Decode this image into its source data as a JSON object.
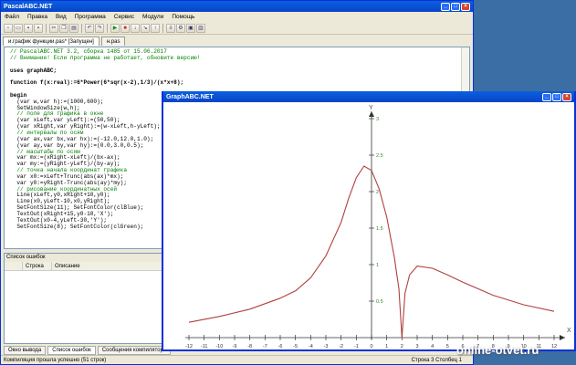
{
  "ide": {
    "title": "PascalABC.NET",
    "menu": [
      "Файл",
      "Правка",
      "Вид",
      "Программа",
      "Сервис",
      "Модули",
      "Помощь"
    ],
    "tabs": [
      "и.график функции.pas* [Запущен]",
      "н.pas"
    ],
    "code_lines": [
      {
        "t": "// PascalABC.NET 3.2, сборка 1485 от 15.06.2017",
        "c": "cm"
      },
      {
        "t": "// Внимание! Если программа не работает, обновите версию!",
        "c": "cm"
      },
      {
        "t": "",
        "c": ""
      },
      {
        "t": "uses graphABC;",
        "c": "kw"
      },
      {
        "t": "",
        "c": ""
      },
      {
        "t": "function f(x:real):=6*Power(6*sqr(x-2),1/3)/(x*x+8);",
        "c": "kw"
      },
      {
        "t": "",
        "c": ""
      },
      {
        "t": "begin",
        "c": "kw"
      },
      {
        "t": "  (var w,var h):=(1000,600);",
        "c": ""
      },
      {
        "t": "  SetWindowSize(w,h);",
        "c": ""
      },
      {
        "t": "  // поле для графика в окне",
        "c": "cm"
      },
      {
        "t": "  (var xLeft,var yLeft):=(50,50);",
        "c": ""
      },
      {
        "t": "  (var xRight,var yRight):=(w-xLeft,h-yLeft);",
        "c": ""
      },
      {
        "t": "  // интервалы по осям",
        "c": "cm"
      },
      {
        "t": "  (var ax,var bx,var hx):=(-12.0,12.0,1.0);",
        "c": ""
      },
      {
        "t": "  (var ay,var by,var hy):=(0.0,3.0,0.5);",
        "c": ""
      },
      {
        "t": "  // масштабы по осям",
        "c": "cm"
      },
      {
        "t": "  var mx:=(xRight-xLeft)/(bx-ax);",
        "c": ""
      },
      {
        "t": "  var my:=(yRight-yLeft)/(by-ay);",
        "c": ""
      },
      {
        "t": "  // точка начала координат графика",
        "c": "cm"
      },
      {
        "t": "  var x0:=xLeft+Trunc(abs(ax)*mx);",
        "c": ""
      },
      {
        "t": "  var y0:=yRight-Trunc(abs(ay)*my);",
        "c": ""
      },
      {
        "t": "  // рисование координатных осей",
        "c": "cm"
      },
      {
        "t": "  Line(xLeft,y0,xRight+10,y0);",
        "c": ""
      },
      {
        "t": "  Line(x0,yLeft-10,x0,yRight);",
        "c": ""
      },
      {
        "t": "  SetFontSize(11); SetFontColor(clBlue);",
        "c": ""
      },
      {
        "t": "  TextOut(xRight+15,y0-10,'X');",
        "c": ""
      },
      {
        "t": "  TextOut(x0-4,yLeft-30,'Y');",
        "c": ""
      },
      {
        "t": "  SetFontSize(8); SetFontColor(clGreen);",
        "c": ""
      }
    ],
    "error_panel": {
      "title": "Список ошибок",
      "col_line": "Строка",
      "col_desc": "Описание"
    },
    "bottom_tabs": [
      "Окно вывода",
      "Список ошибок",
      "Сообщения компилятора"
    ],
    "status_left": "Компиляция прошла успешно (51 строк)",
    "status_right": "Строка  3  Столбец  1"
  },
  "graph": {
    "title": "GraphABC.NET",
    "axis_x_label": "X",
    "axis_y_label": "Y",
    "curve_color": "#b04040",
    "axis_color": "#333333",
    "y_label_color": "#2e8b2e",
    "watermark": "online-otvet.ru"
  },
  "chart_data": {
    "type": "line",
    "title": "",
    "xlabel": "X",
    "ylabel": "Y",
    "xlim": [
      -12,
      12
    ],
    "ylim": [
      0,
      3
    ],
    "x_ticks": [
      -12,
      -11,
      -10,
      -9,
      -8,
      -7,
      -6,
      -5,
      -4,
      -3,
      -2,
      -1,
      0,
      1,
      2,
      3,
      4,
      5,
      6,
      7,
      8,
      9,
      10,
      11,
      12
    ],
    "y_ticks": [
      0.5,
      1,
      1.5,
      2,
      2.5,
      3
    ],
    "series": [
      {
        "x": [
          -12,
          -10,
          -8,
          -6,
          -5,
          -4,
          -3,
          -2,
          -1.5,
          -1,
          -0.5,
          0,
          0.5,
          1,
          1.5,
          1.8,
          2,
          2.2,
          2.5,
          3,
          4,
          5,
          6,
          8,
          10,
          12
        ],
        "y": [
          0.21,
          0.29,
          0.39,
          0.54,
          0.64,
          0.82,
          1.12,
          1.58,
          1.91,
          2.19,
          2.35,
          2.29,
          2.04,
          1.65,
          1.1,
          0.67,
          0.0,
          0.61,
          0.86,
          0.98,
          0.95,
          0.86,
          0.76,
          0.58,
          0.45,
          0.36
        ]
      }
    ]
  }
}
